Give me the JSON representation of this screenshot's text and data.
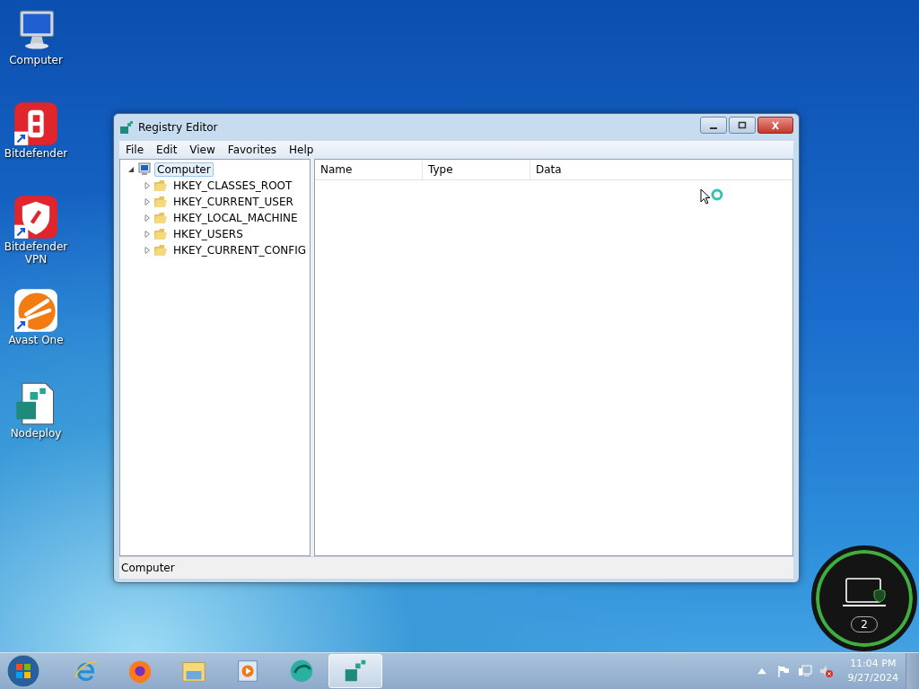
{
  "desktop_icons": [
    {
      "label": "Computer",
      "kind": "computer",
      "shortcut": false
    },
    {
      "label": "Bitdefender",
      "kind": "bitdefender",
      "shortcut": true
    },
    {
      "label": "Bitdefender VPN",
      "kind": "vpn",
      "shortcut": true
    },
    {
      "label": "Avast One",
      "kind": "avast",
      "shortcut": true
    },
    {
      "label": "Nodeploy",
      "kind": "regfile",
      "shortcut": false
    }
  ],
  "window": {
    "title": "Registry Editor",
    "menu": [
      "File",
      "Edit",
      "View",
      "Favorites",
      "Help"
    ],
    "tree": {
      "label": "Computer",
      "expanded": true,
      "selected": true,
      "children": [
        {
          "label": "HKEY_CLASSES_ROOT",
          "expanded": false,
          "selected": false
        },
        {
          "label": "HKEY_CURRENT_USER",
          "expanded": false,
          "selected": false
        },
        {
          "label": "HKEY_LOCAL_MACHINE",
          "expanded": false,
          "selected": false
        },
        {
          "label": "HKEY_USERS",
          "expanded": false,
          "selected": false
        },
        {
          "label": "HKEY_CURRENT_CONFIG",
          "expanded": false,
          "selected": false
        }
      ]
    },
    "columns": [
      "Name",
      "Type",
      "Data"
    ],
    "status_bar": "Computer"
  },
  "security_widget": {
    "count": "2"
  },
  "taskbar": {
    "apps": [
      {
        "kind": "ie",
        "selected": false
      },
      {
        "kind": "firefox",
        "selected": false
      },
      {
        "kind": "explorer",
        "selected": false
      },
      {
        "kind": "media",
        "selected": false
      },
      {
        "kind": "green",
        "selected": false
      },
      {
        "kind": "regedit",
        "selected": true
      }
    ],
    "time": "11:04 PM",
    "date": "9/27/2024"
  }
}
